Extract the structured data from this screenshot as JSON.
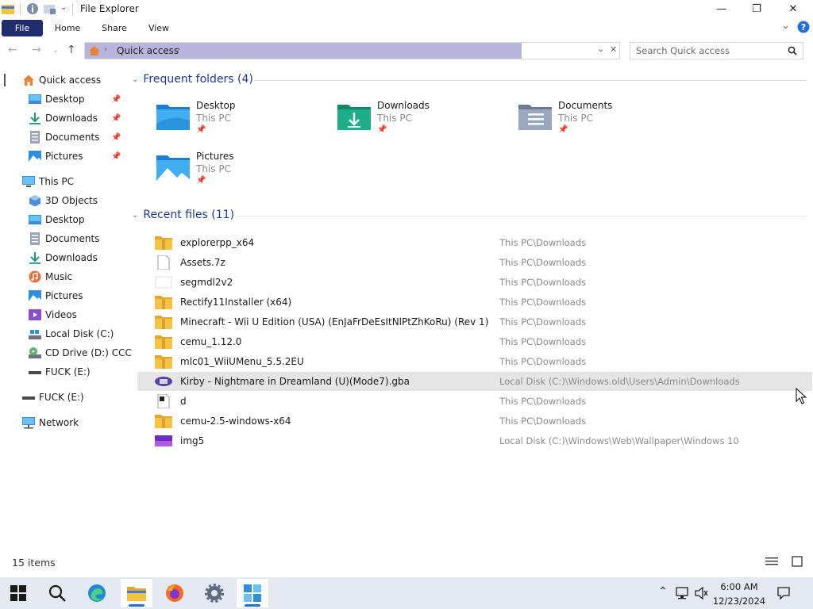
{
  "window": {
    "title": "File Explorer",
    "controls": {
      "minimize": "—",
      "maximize": "❐",
      "close": "✕"
    }
  },
  "ribbon": {
    "tabs": [
      "File",
      "Home",
      "Share",
      "View"
    ]
  },
  "navbar": {
    "address": "Quick access",
    "search_placeholder": "Search Quick access"
  },
  "sidebar": {
    "items": [
      {
        "label": "Quick access",
        "icon": "home-icon"
      },
      {
        "label": "Desktop",
        "icon": "desktop-icon",
        "pinned": true
      },
      {
        "label": "Downloads",
        "icon": "download-icon",
        "pinned": true
      },
      {
        "label": "Documents",
        "icon": "documents-icon",
        "pinned": true
      },
      {
        "label": "Pictures",
        "icon": "pictures-icon",
        "pinned": true
      },
      {
        "label": "This PC",
        "icon": "computer-icon"
      },
      {
        "label": "3D Objects",
        "icon": "cube-icon"
      },
      {
        "label": "Desktop",
        "icon": "desktop-icon"
      },
      {
        "label": "Documents",
        "icon": "documents-icon"
      },
      {
        "label": "Downloads",
        "icon": "download-icon"
      },
      {
        "label": "Music",
        "icon": "music-icon"
      },
      {
        "label": "Pictures",
        "icon": "pictures-icon"
      },
      {
        "label": "Videos",
        "icon": "video-icon"
      },
      {
        "label": "Local Disk (C:)",
        "icon": "disk-icon"
      },
      {
        "label": "CD Drive (D:) CCC",
        "icon": "cd-icon"
      },
      {
        "label": "FUCK (E:)",
        "icon": "usb-drive-icon"
      },
      {
        "label": "FUCK (E:)",
        "icon": "usb-drive-icon"
      },
      {
        "label": "Network",
        "icon": "network-icon"
      }
    ]
  },
  "frequent": {
    "header": "Frequent folders (4)",
    "folders": [
      {
        "name": "Desktop",
        "location": "This PC",
        "icon": "desktop-folder-icon"
      },
      {
        "name": "Downloads",
        "location": "This PC",
        "icon": "downloads-folder-icon"
      },
      {
        "name": "Documents",
        "location": "This PC",
        "icon": "documents-folder-icon"
      },
      {
        "name": "Pictures",
        "location": "This PC",
        "icon": "pictures-folder-icon"
      }
    ]
  },
  "recent": {
    "header": "Recent files (11)",
    "files": [
      {
        "name": "explorerpp_x64",
        "path": "This PC\\Downloads",
        "icon": "zip-folder-icon"
      },
      {
        "name": "Assets.7z",
        "path": "This PC\\Downloads",
        "icon": "file-icon"
      },
      {
        "name": "segmdl2v2",
        "path": "This PC\\Downloads",
        "icon": "blank-file-icon"
      },
      {
        "name": "Rectify11Installer (x64)",
        "path": "This PC\\Downloads",
        "icon": "zip-folder-icon"
      },
      {
        "name": "Minecraft - Wii U Edition (USA) (EnJaFrDeEsItNlPtZhKoRu) (Rev 1)",
        "path": "This PC\\Downloads",
        "icon": "zip-folder-icon"
      },
      {
        "name": "cemu_1.12.0",
        "path": "This PC\\Downloads",
        "icon": "zip-folder-icon"
      },
      {
        "name": "mlc01_WiiUMenu_5.5.2EU",
        "path": "This PC\\Downloads",
        "icon": "zip-folder-icon"
      },
      {
        "name": "Kirby - Nightmare in Dreamland (U)(Mode7).gba",
        "path": "Local Disk (C:)\\Windows.old\\Users\\Admin\\Downloads",
        "icon": "gba-file-icon",
        "selected": true
      },
      {
        "name": "d",
        "path": "This PC\\Downloads",
        "icon": "app-file-icon"
      },
      {
        "name": "cemu-2.5-windows-x64",
        "path": "This PC\\Downloads",
        "icon": "zip-folder-icon"
      },
      {
        "name": "img5",
        "path": "Local Disk (C:)\\Windows\\Web\\Wallpaper\\Windows 10",
        "icon": "image-file-icon"
      }
    ]
  },
  "status": {
    "items": "15 items"
  },
  "taskbar": {
    "apps": [
      "start",
      "search",
      "edge",
      "file-explorer",
      "firefox",
      "settings",
      "app"
    ],
    "time": "6:00 AM",
    "date": "12/23/2024"
  },
  "colors": {
    "accent": "#1f2d6e",
    "address_fill": "#b8b5dd",
    "selection": "#e5e5e5",
    "folder_yellow": "#f5c342",
    "header_blue": "#1e3a8a"
  }
}
